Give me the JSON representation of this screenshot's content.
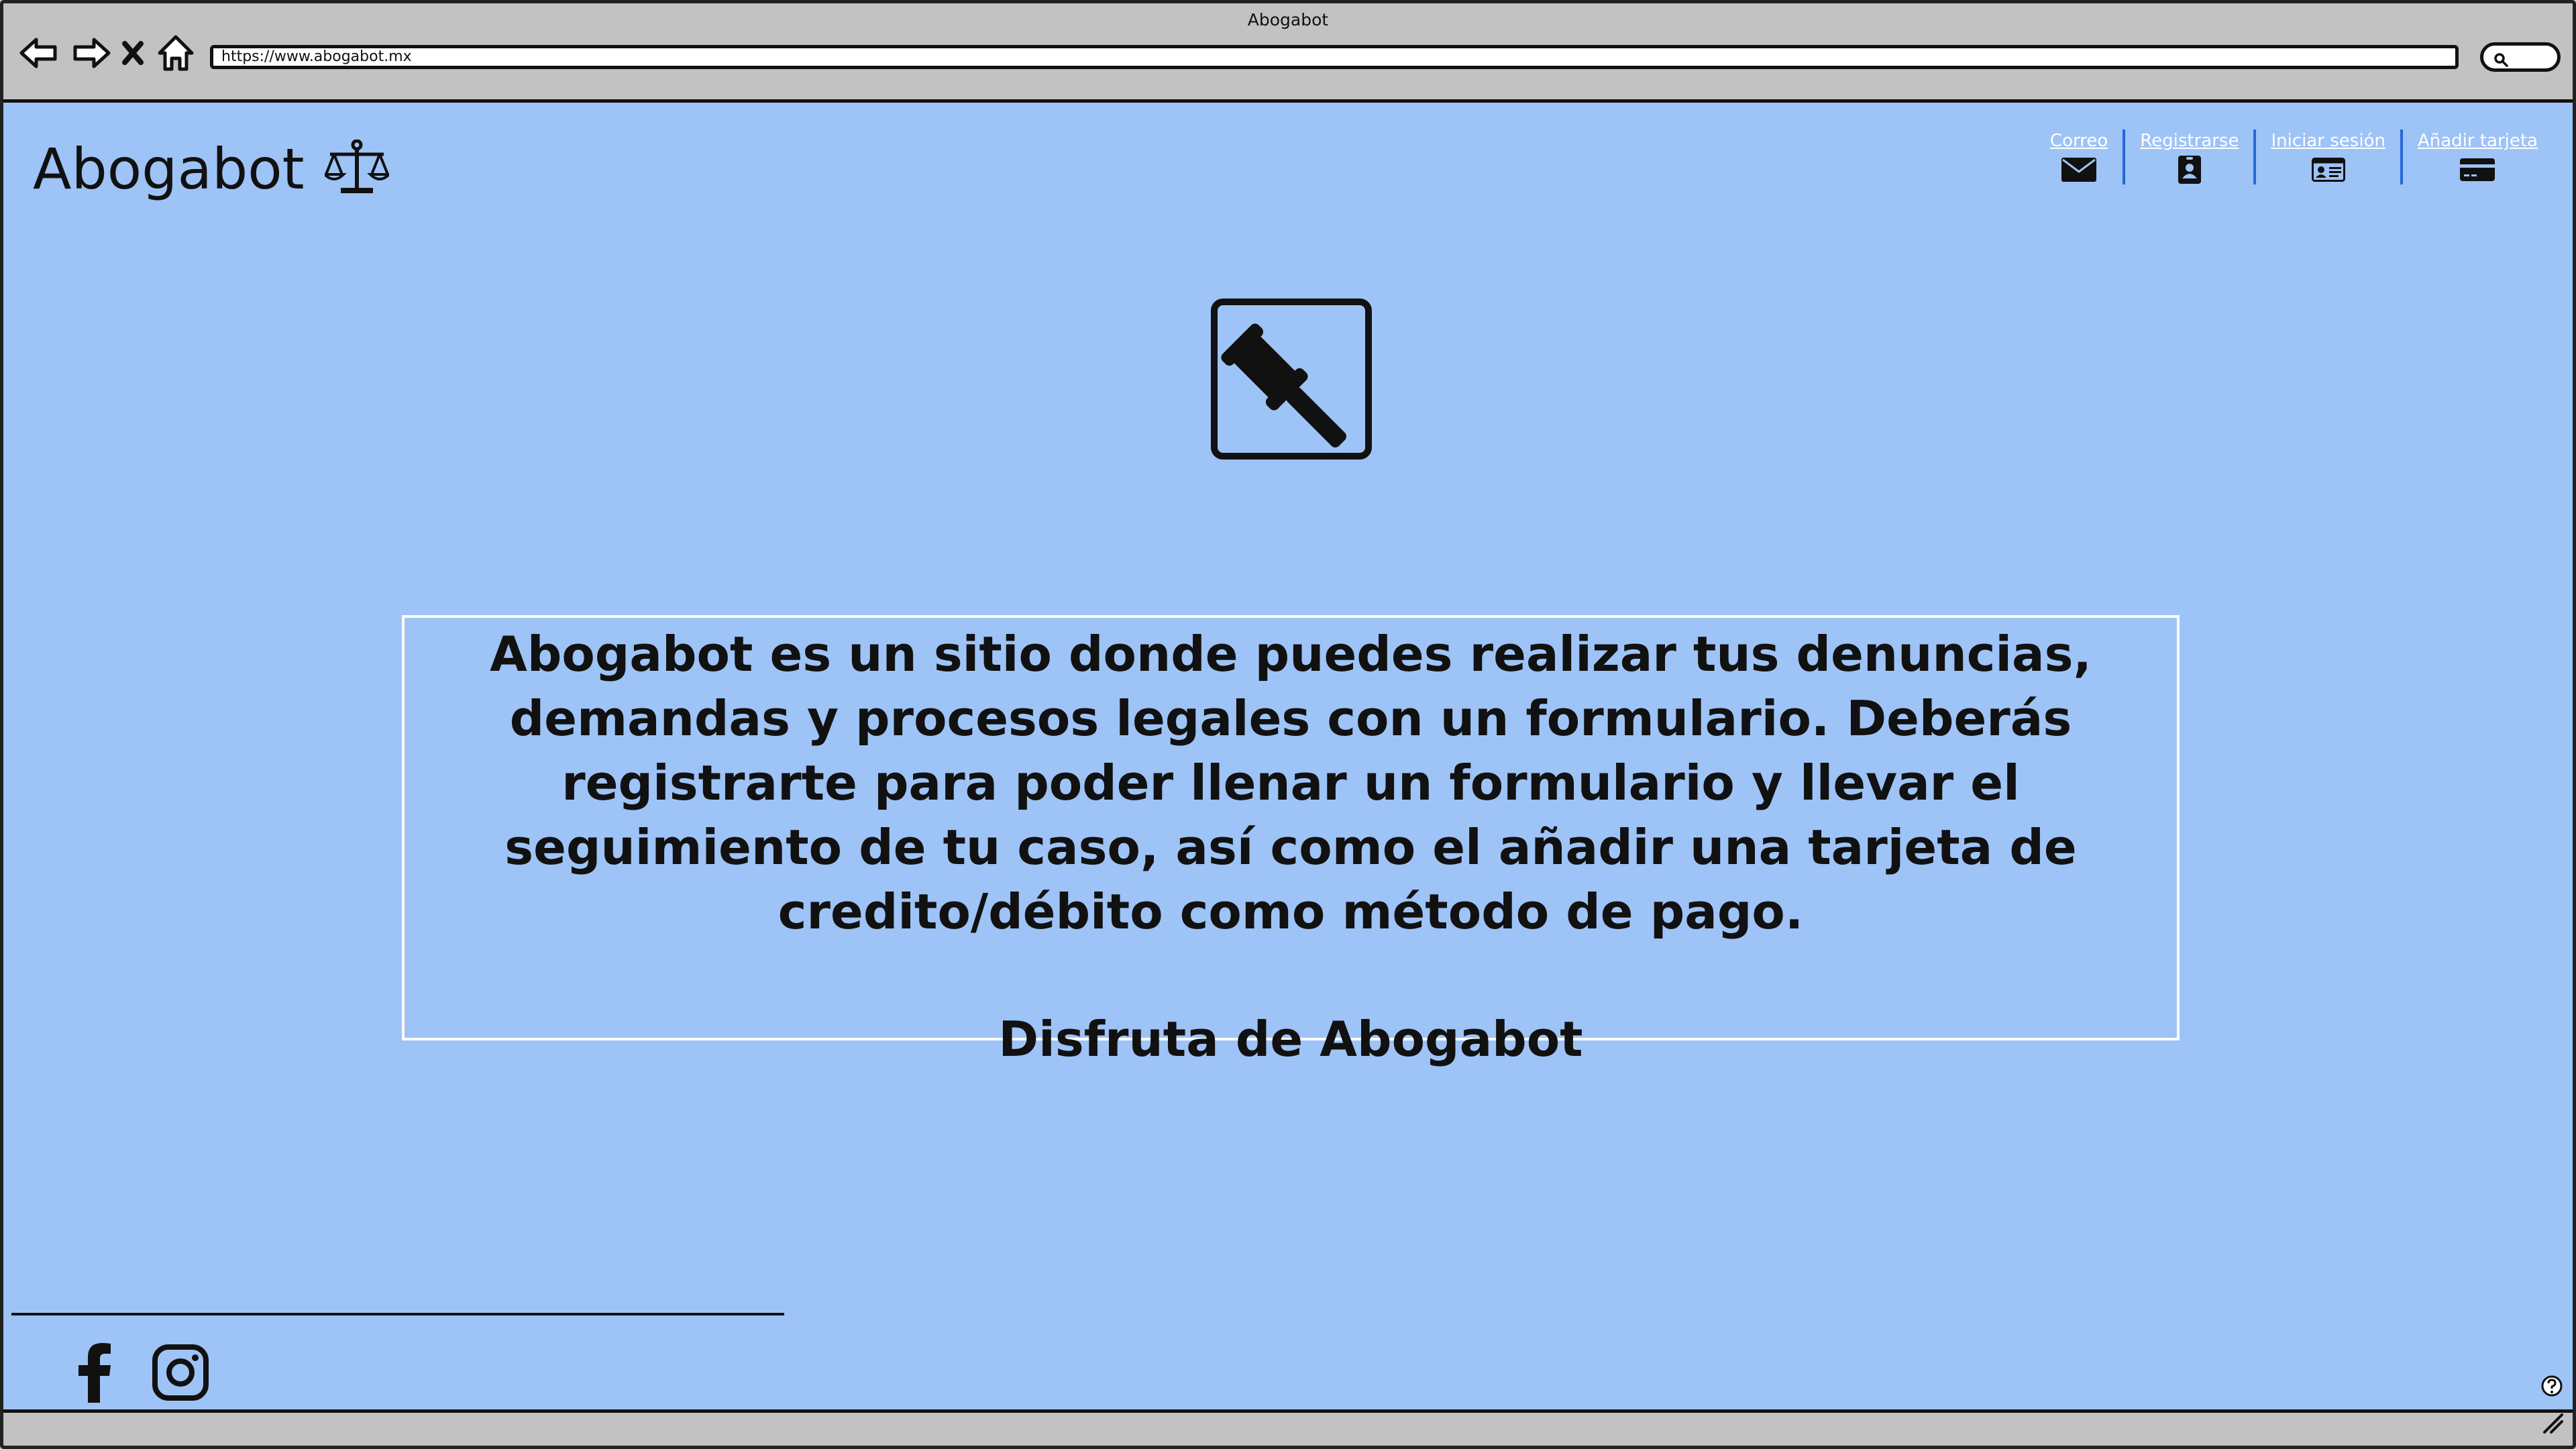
{
  "window": {
    "title": "Abogabot",
    "address_url": "https://www.abogabot.mx"
  },
  "header": {
    "brand_name": "Abogabot",
    "links": [
      {
        "label": "Correo",
        "icon": "envelope-icon"
      },
      {
        "label": "Registrarse",
        "icon": "contact-badge-icon"
      },
      {
        "label": "Iniciar sesión",
        "icon": "id-card-icon"
      },
      {
        "label": "Añadir tarjeta",
        "icon": "credit-card-icon"
      }
    ]
  },
  "main": {
    "hero_icon": "gavel-icon",
    "description": "Abogabot es un sitio donde puedes realizar tus denuncias, demandas y procesos legales con un formulario. Deberás registrarte para poder llenar un formulario y llevar el seguimiento de tu caso, así como el añadir una tarjeta de credito/débito como método de pago.",
    "tagline": "Disfruta de Abogabot"
  },
  "footer": {
    "social": [
      "facebook-icon",
      "instagram-icon"
    ]
  },
  "colors": {
    "page_background": "#9ec3f6",
    "chrome_background": "#c2c2c2",
    "link_text": "#ffffff",
    "link_separator": "#2468d8"
  }
}
